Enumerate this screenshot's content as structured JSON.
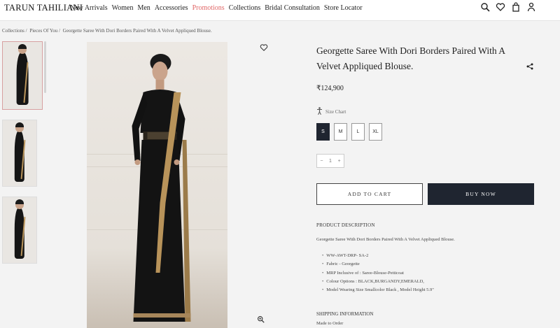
{
  "header": {
    "logo": "TARUN TAHILIANI",
    "nav": [
      "New Arrivals",
      "Women",
      "Men",
      "Accessories",
      "Promotions",
      "Collections",
      "Bridal Consultation",
      "Store Locator"
    ],
    "nav_promo_color": "#e06666",
    "icons": [
      "search-icon",
      "heart-icon",
      "bag-icon",
      "user-icon"
    ]
  },
  "breadcrumb": [
    "Collections /",
    "Pieces Of You /",
    "Georgette Saree With Dori Borders Paired With A Velvet Appliqued Blouse."
  ],
  "gallery": {
    "thumbnails": 3,
    "icons": [
      "wishlist-heart-icon",
      "zoom-icon"
    ]
  },
  "product": {
    "title": "Georgette Saree With Dori Borders Paired With A Velvet Appliqued Blouse.",
    "price": "₹124,900",
    "size_chart_label": "Size Chart",
    "sizes": [
      "S",
      "M",
      "L",
      "XL"
    ],
    "selected_size": "S",
    "quantity": "1",
    "qty_minus": "−",
    "qty_plus": "+",
    "add_to_cart": "ADD TO CART",
    "buy_now": "BUY NOW",
    "accent_color": "#1f2530"
  },
  "description": {
    "heading": "PRODUCT DESCRIPTION",
    "text": "Georgette Saree With Dori Borders Paired With A Velvet Appliqued Blouse.",
    "bullets": [
      "WW-AWT-DRP- SA-2",
      "Fabric - Georgette",
      "MRP Inclusive of : Saree-Blouse-Petticoat",
      "Colour Options : BLACK,BURGANDY,EMERALD,",
      "Model Wearing Size Smallcolor Black , Model Height 5.9\""
    ]
  },
  "shipping": {
    "heading": "SHIPPING INFORMATION",
    "text": "Made to Order"
  }
}
